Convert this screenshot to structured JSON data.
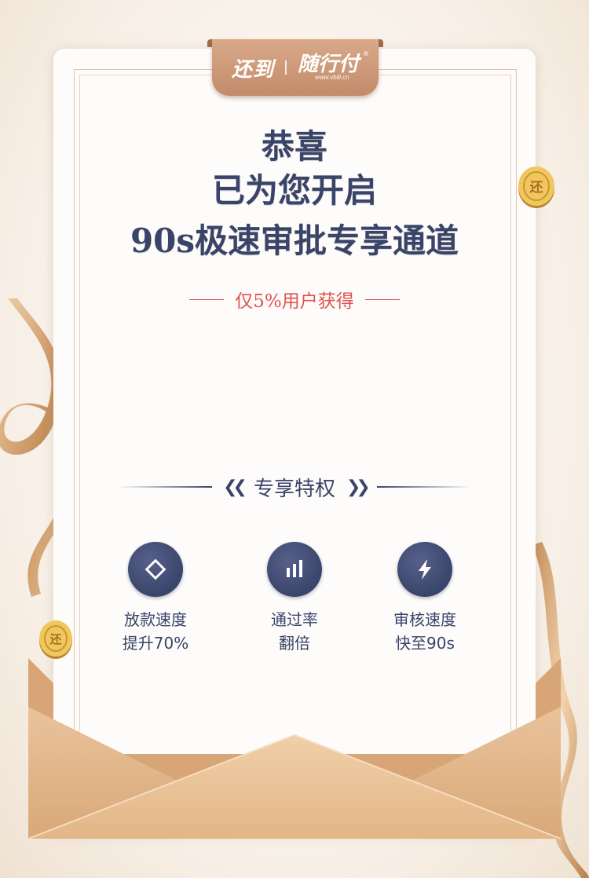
{
  "brand": {
    "primary": "还到",
    "secondary": "随行付",
    "url": "www.vbill.cn",
    "registered_mark": "®"
  },
  "headline": {
    "line1": "恭喜",
    "line2": "已为您开启",
    "line3": "90s极速审批专享通道"
  },
  "subtitle": "仅5%用户获得",
  "privileges": {
    "title": "专享特权",
    "items": [
      {
        "icon": "diamond-icon",
        "line1": "放款速度",
        "line2": "提升70%"
      },
      {
        "icon": "bar-chart-icon",
        "line1": "通过率",
        "line2": "翻倍"
      },
      {
        "icon": "lightning-icon",
        "line1": "审核速度",
        "line2": "快至90s"
      }
    ]
  },
  "coin_glyph": "还",
  "colors": {
    "navy": "#3a4468",
    "red": "#e0534f",
    "gold": "#d4a24a",
    "envelope": "#e1b88f"
  }
}
